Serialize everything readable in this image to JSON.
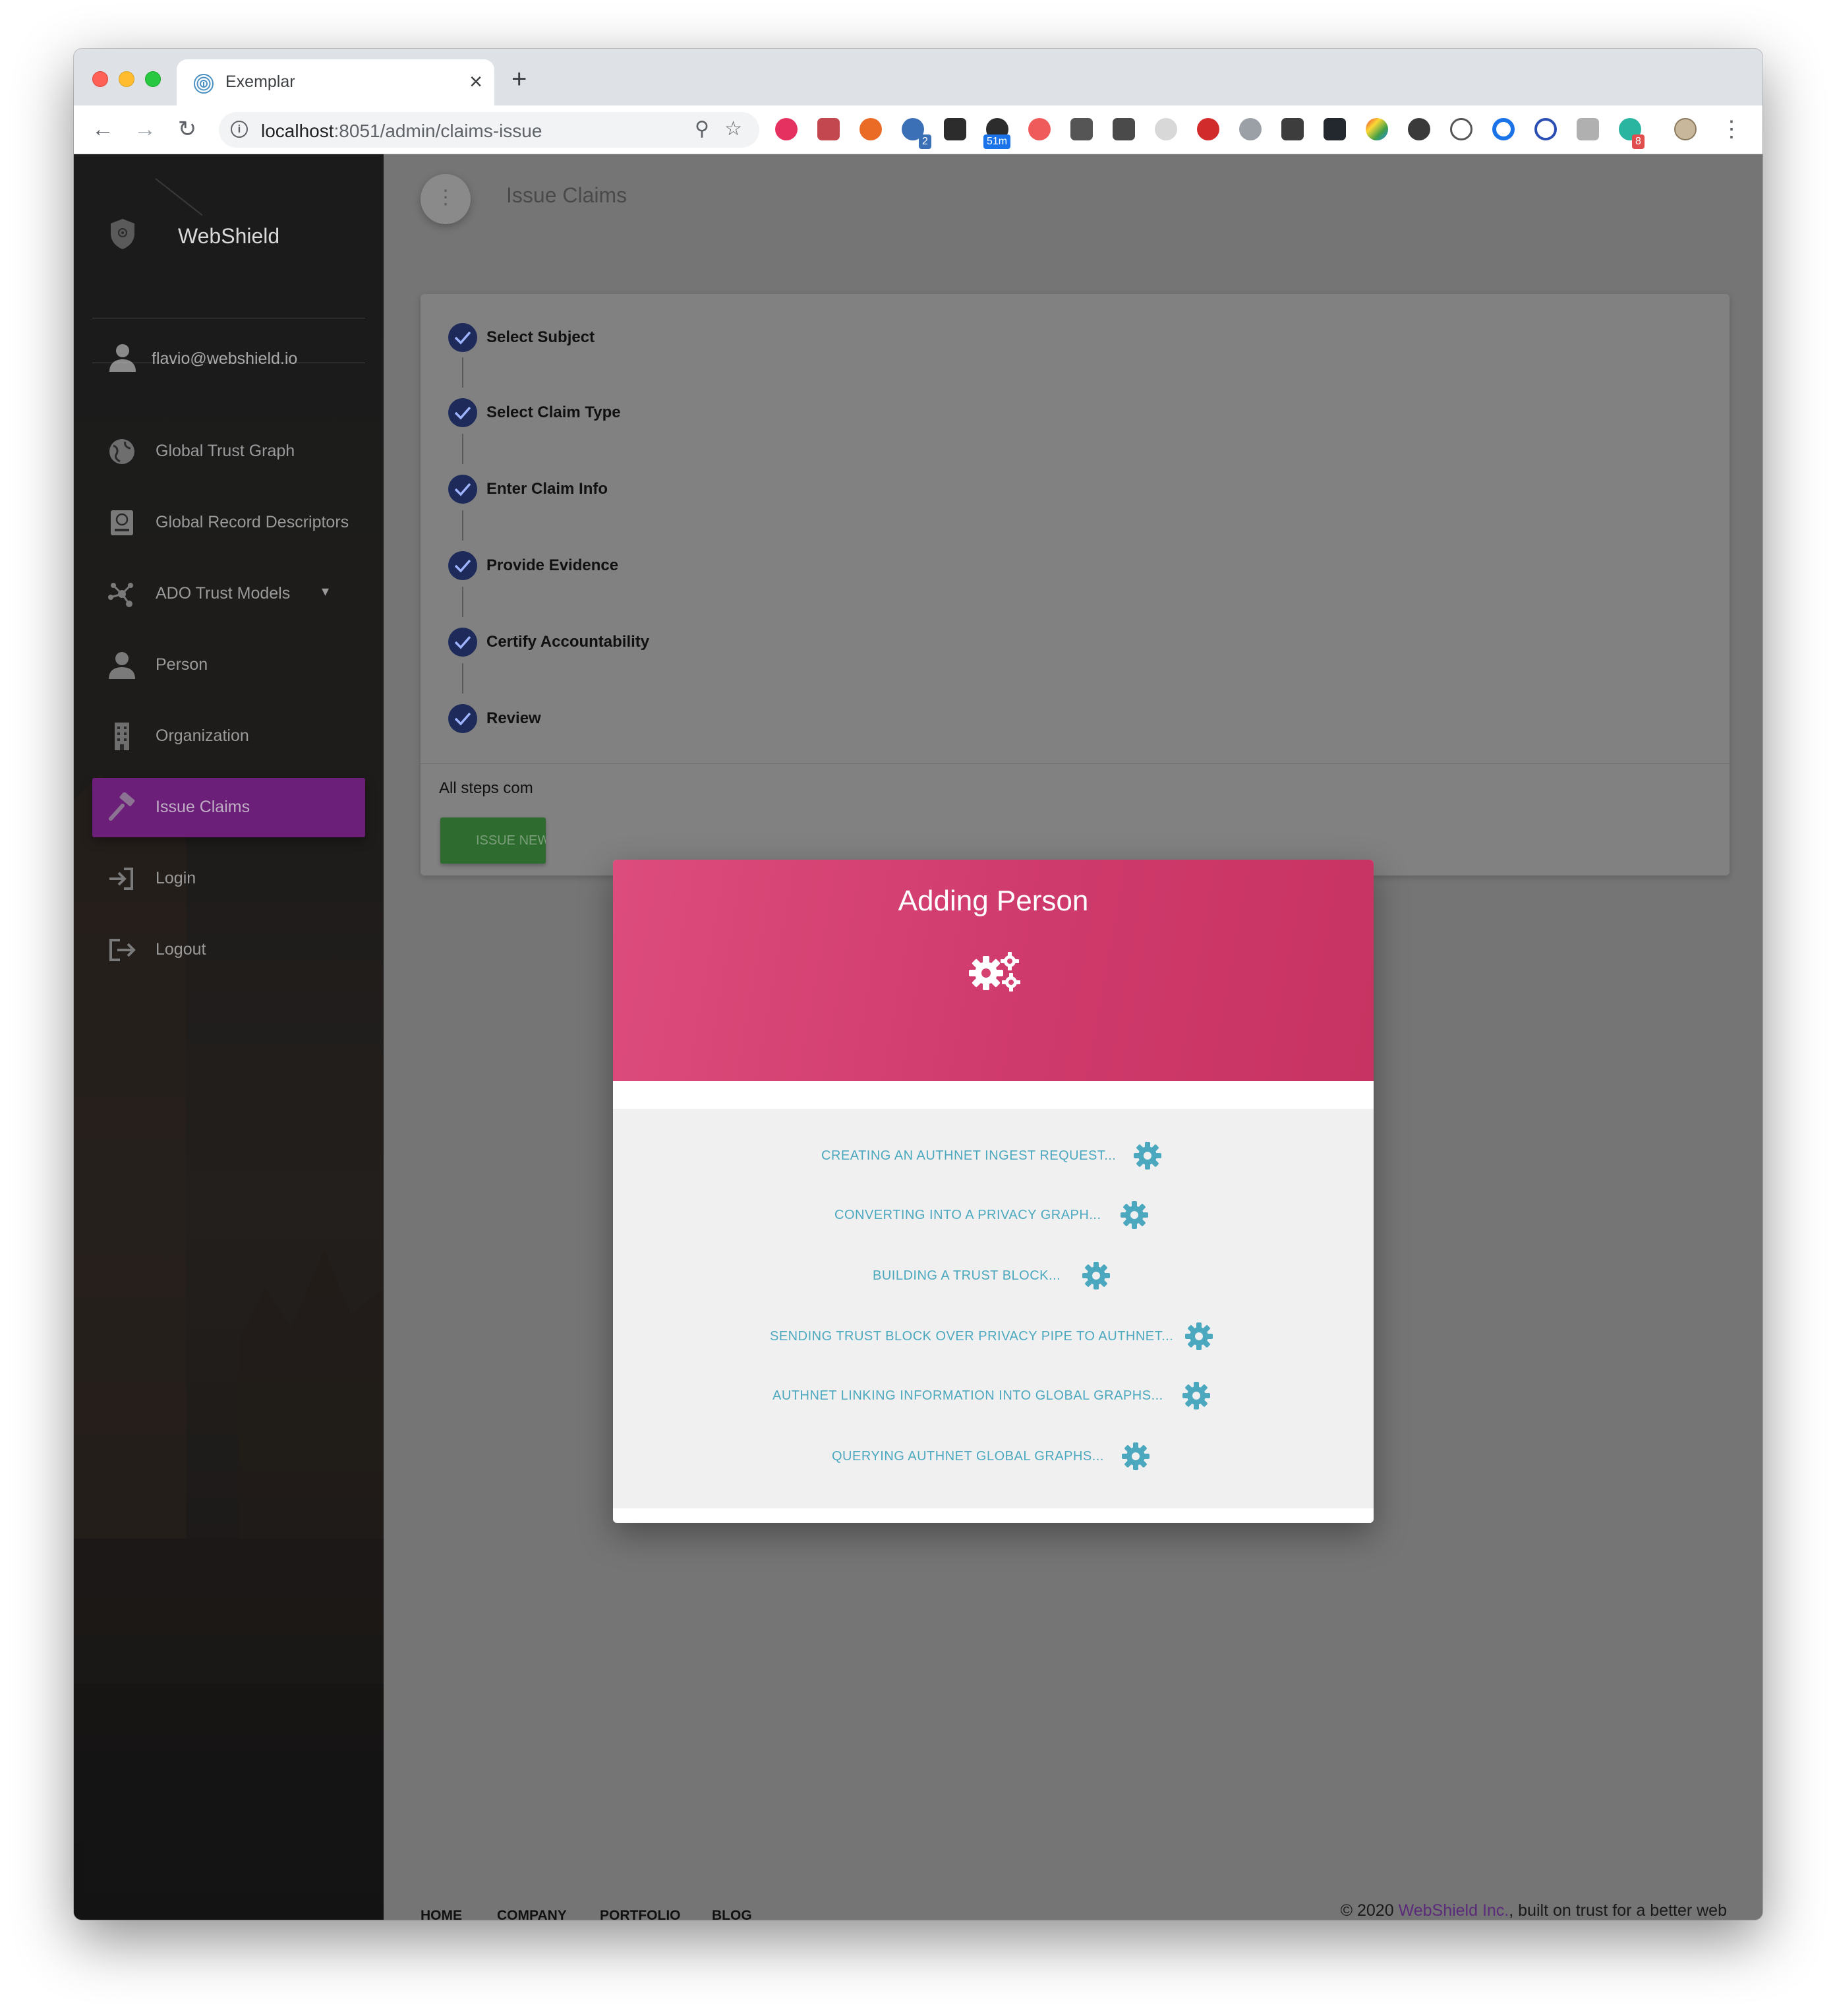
{
  "browser": {
    "tab_title": "Exemplar",
    "tab_close": "×",
    "new_tab": "+",
    "url_host": "localhost",
    "url_rest": ":8051/admin/claims-issue",
    "badges": {
      "ext_2": "2",
      "ext_51m": "51m",
      "ext_8": "8"
    }
  },
  "sidebar": {
    "brand": "WebShield",
    "user_email": "flavio@webshield.io",
    "items": [
      {
        "label": "Global Trust Graph",
        "icon": "globe-icon"
      },
      {
        "label": "Global Record Descriptors",
        "icon": "record-descriptor-icon"
      },
      {
        "label": "ADO Trust Models",
        "icon": "network-icon",
        "caret": "▾"
      },
      {
        "label": "Person",
        "icon": "person-icon"
      },
      {
        "label": "Organization",
        "icon": "building-icon"
      },
      {
        "label": "Issue Claims",
        "icon": "gavel-icon",
        "active": true
      },
      {
        "label": "Login",
        "icon": "login-icon"
      },
      {
        "label": "Logout",
        "icon": "logout-icon"
      }
    ]
  },
  "main": {
    "fab_icon": "⋮",
    "page_title": "Issue Claims",
    "steps": [
      {
        "label": "Select Subject"
      },
      {
        "label": "Select Claim Type"
      },
      {
        "label": "Enter Claim Info"
      },
      {
        "label": "Provide Evidence"
      },
      {
        "label": "Certify Accountability"
      },
      {
        "label": "Review"
      }
    ],
    "all_steps_text": "All steps com",
    "issue_button": "ISSUE NEW"
  },
  "modal": {
    "title": "Adding Person",
    "statuses": [
      "CREATING AN AUTHNET INGEST REQUEST...",
      "CONVERTING INTO A PRIVACY GRAPH...",
      "BUILDING A TRUST BLOCK...",
      "SENDING TRUST BLOCK OVER PRIVACY PIPE TO AUTHNET...",
      "AUTHNET LINKING INFORMATION INTO GLOBAL GRAPHS...",
      "QUERYING AUTHNET GLOBAL GRAPHS..."
    ]
  },
  "footer": {
    "links": [
      "HOME",
      "COMPANY",
      "PORTFOLIO",
      "BLOG"
    ],
    "copyright_prefix": "© 2020 ",
    "copyright_link": "WebShield Inc.",
    "copyright_suffix": ", built on trust for a better web"
  },
  "colors": {
    "sidebar_active": "#6b1f78",
    "modal_header": "#d6426f",
    "status_text": "#4ba8bf",
    "step_check": "#1e2a5a",
    "issue_button": "#2e6b2e"
  }
}
